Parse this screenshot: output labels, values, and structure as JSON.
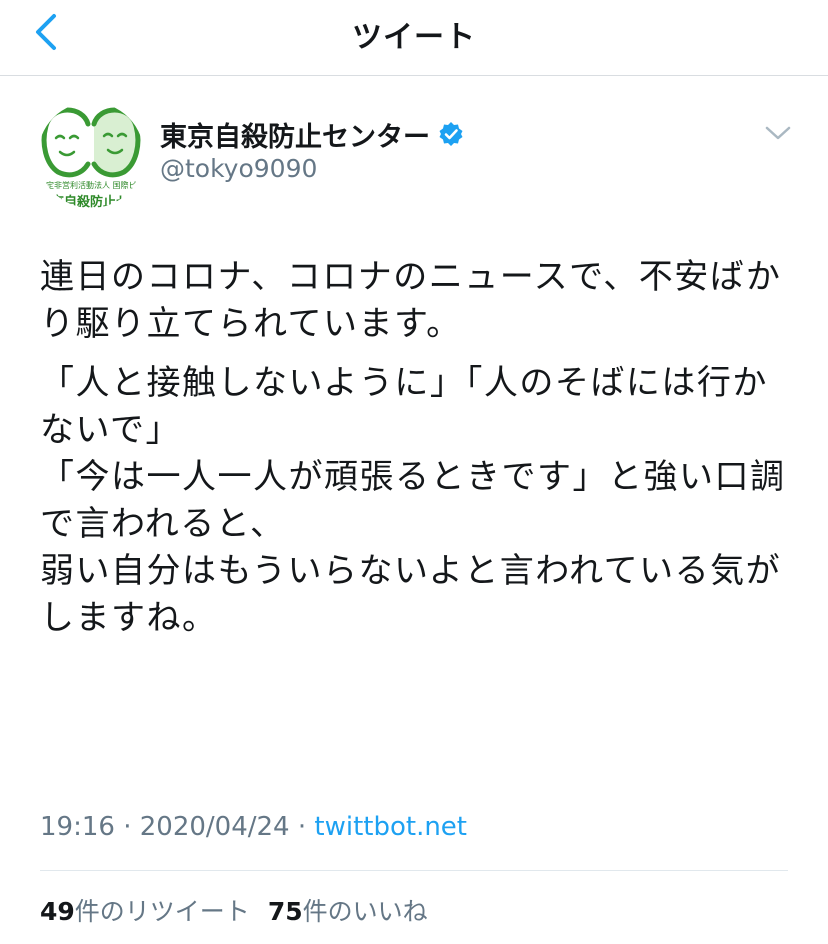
{
  "header": {
    "title": "ツイート",
    "back_icon": "chevron-left-icon"
  },
  "colors": {
    "accent": "#1da1f2",
    "secondary_text": "#657786",
    "logo_green": "#2f8a2a"
  },
  "tweet": {
    "display_name": "東京自殺防止センター",
    "verified": true,
    "handle": "@tokyo9090",
    "avatar_logo_text_top": "特定非営利活動法人 国際ビフレンダーズ",
    "avatar_logo_text_bottom": "東京自殺防止センター",
    "paragraphs": [
      "連日のコロナ、コロナのニュースで、不安ばかり駆り立てられています。",
      "「人と接触しないように」「人のそばには行かないで」\n「今は一人一人が頑張るときです」と強い口調で言われると、\n弱い自分はもういらないよと言われている気がしますね。"
    ],
    "time": "19:16",
    "date": "2020/04/24",
    "separator": "·",
    "source": "twittbot.net",
    "retweet_count": "49",
    "retweet_label": "件のリツイート",
    "like_count": "75",
    "like_label": "件のいいね"
  }
}
